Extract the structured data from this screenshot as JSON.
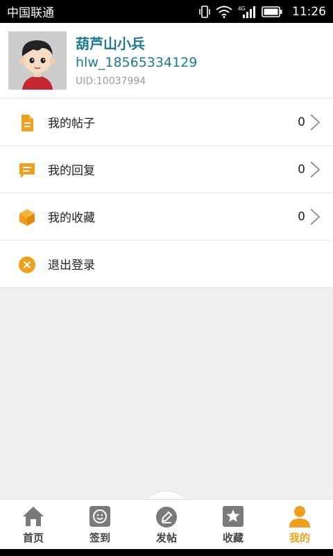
{
  "status_bar": {
    "carrier": "中国联通",
    "network": "4G",
    "time": "11:26"
  },
  "profile": {
    "nickname": "葫芦山小兵",
    "username": "hlw_18565334129",
    "uid": "UID:10037994"
  },
  "menu": [
    {
      "icon": "document-icon",
      "label": "我的帖子",
      "count": "0"
    },
    {
      "icon": "reply-icon",
      "label": "我的回复",
      "count": "0"
    },
    {
      "icon": "box-icon",
      "label": "我的收藏",
      "count": "0"
    },
    {
      "icon": "close-circle-icon",
      "label": "退出登录"
    }
  ],
  "bottom_nav": [
    {
      "icon": "home-icon",
      "label": "首页"
    },
    {
      "icon": "checkin-icon",
      "label": "签到"
    },
    {
      "icon": "edit-icon",
      "label": "发帖"
    },
    {
      "icon": "star-icon",
      "label": "收藏"
    },
    {
      "icon": "person-icon",
      "label": "我的",
      "active": true
    }
  ],
  "colors": {
    "accent": "#f0a01d",
    "name_color": "#1b7a93",
    "nav_gray": "#7a7a7a"
  }
}
